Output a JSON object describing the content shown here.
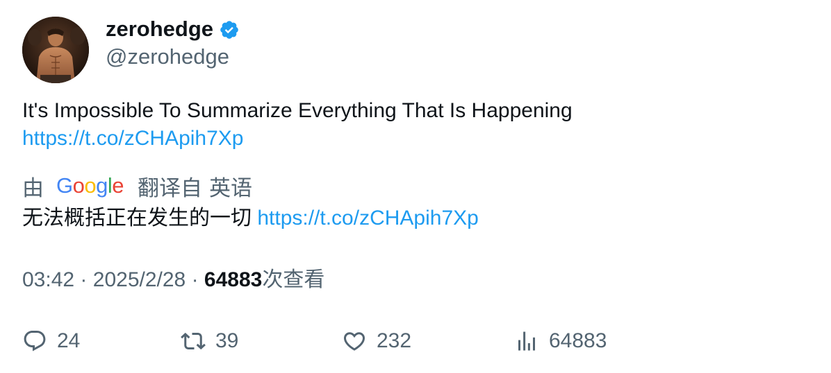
{
  "author": {
    "display_name": "zerohedge",
    "handle": "@zerohedge",
    "verified": true
  },
  "tweet": {
    "text": "It's Impossible To Summarize Everything That Is Happening",
    "link": "https://t.co/zCHApih7Xp"
  },
  "translation": {
    "by_label": "由",
    "provider": [
      "G",
      "o",
      "o",
      "g",
      "l",
      "e"
    ],
    "provider_colors": [
      "#4285F4",
      "#EA4335",
      "#FBBC05",
      "#4285F4",
      "#34A853",
      "#EA4335"
    ],
    "translated_from_label": "翻译自",
    "source_language": "英语",
    "text": "无法概括正在发生的一切",
    "link": "https://t.co/zCHApih7Xp"
  },
  "meta": {
    "time": "03:42",
    "separator": "·",
    "date": "2025/2/28",
    "views_count": "64883",
    "views_label": "次查看"
  },
  "actions": {
    "reply": {
      "icon": "reply-icon",
      "count": "24"
    },
    "retweet": {
      "icon": "retweet-icon",
      "count": "39"
    },
    "like": {
      "icon": "heart-icon",
      "count": "232"
    },
    "views": {
      "icon": "analytics-icon",
      "count": "64883"
    }
  },
  "colors": {
    "link": "#1d9bf0",
    "secondary_text": "#536471",
    "primary_text": "#0f1419",
    "verified": "#1d9bf0"
  }
}
